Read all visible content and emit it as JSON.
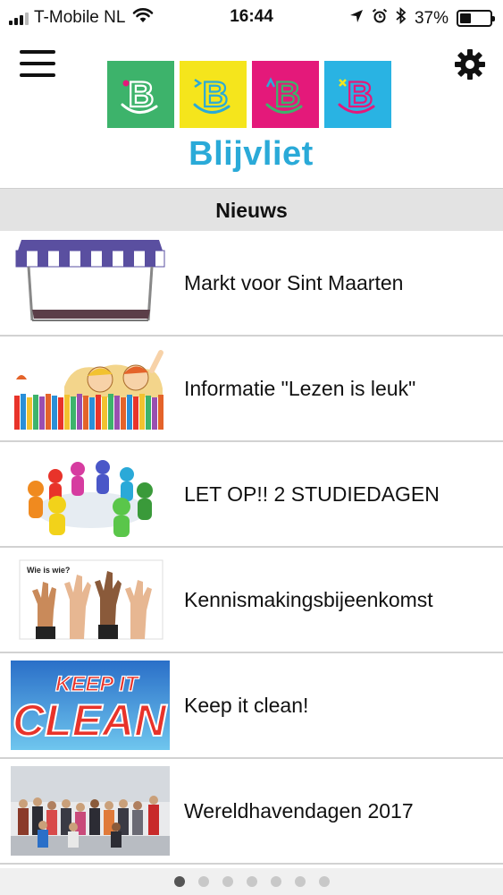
{
  "status_bar": {
    "carrier": "T-Mobile NL",
    "time": "16:44",
    "battery_percent": "37%",
    "battery_level": 0.37,
    "icons": [
      "signal-icon",
      "wifi-icon",
      "location-icon",
      "alarm-icon",
      "bluetooth-icon",
      "battery-icon"
    ]
  },
  "header": {
    "logo_text": "Blijvliet",
    "logo_tile_colors": [
      "#3db36b",
      "#f5e51c",
      "#e4197a",
      "#29b3e3"
    ],
    "menu_icon": "hamburger-icon",
    "settings_icon": "gear-icon"
  },
  "section": {
    "title": "Nieuws"
  },
  "news": {
    "items": [
      {
        "title": "Markt voor Sint Maarten",
        "image": "market-stall-image"
      },
      {
        "title": "Informatie \"Lezen is leuk\"",
        "image": "kids-reading-books-image"
      },
      {
        "title": "LET OP!! 2 STUDIEDAGEN",
        "image": "colorful-figures-table-image"
      },
      {
        "title": "Kennismakingsbijeenkomst",
        "image": "raised-hands-image"
      },
      {
        "title": "Keep it clean!",
        "image": "keep-it-clean-image"
      },
      {
        "title": "Wereldhavendagen 2017",
        "image": "group-photo-image"
      }
    ]
  },
  "thumb_texts": {
    "wie_is_wie": "Wie is wie?",
    "keep_it": "KEEP IT",
    "clean": "CLEAN"
  },
  "pagination": {
    "total": 7,
    "active": 1
  }
}
